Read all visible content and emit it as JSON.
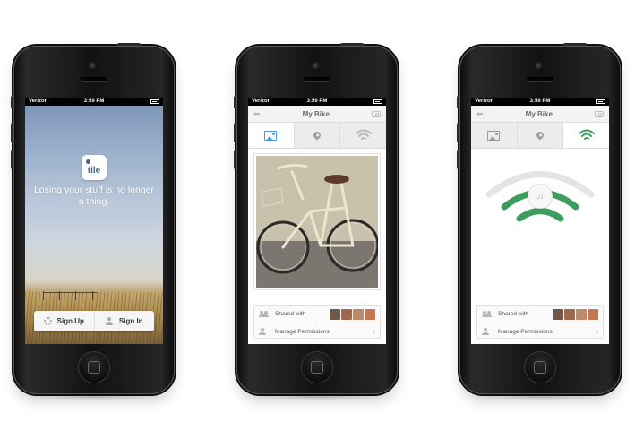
{
  "phones": [
    {
      "status": {
        "carrier": "Verizon",
        "time": "3:59 PM"
      },
      "login": {
        "logo_text": "tile",
        "tagline": "Losing your stuff is no longer a thing.",
        "signup_label": "Sign Up",
        "signin_label": "Sign In"
      }
    },
    {
      "status": {
        "carrier": "Verizon",
        "time": "3:59 PM"
      },
      "nav": {
        "title": "My Bike",
        "back_icon": "arrow-left-icon",
        "action_icon": "camera-icon"
      },
      "tabs": [
        {
          "icon": "photo-icon",
          "active": true
        },
        {
          "icon": "location-pin-icon",
          "active": false
        },
        {
          "icon": "wifi-signal-icon",
          "active": false
        }
      ],
      "share": {
        "shared_label": "Shared with",
        "manage_label": "Manage Permissions"
      }
    },
    {
      "status": {
        "carrier": "Verizon",
        "time": "3:59 PM"
      },
      "nav": {
        "title": "My Bike",
        "back_icon": "arrow-left-icon",
        "action_icon": "camera-icon"
      },
      "tabs": [
        {
          "icon": "photo-icon",
          "active": false
        },
        {
          "icon": "location-pin-icon",
          "active": false
        },
        {
          "icon": "wifi-signal-icon",
          "active": true
        }
      ],
      "share": {
        "shared_label": "Shared with",
        "manage_label": "Manage Permissions"
      },
      "signal_level": 0.66,
      "play_icon": "music-note-icon"
    }
  ],
  "colors": {
    "active_blue": "#4a9ad8",
    "signal_green": "#3e9d5e",
    "signal_inactive": "#e4e4e4"
  },
  "avatar_colors": [
    "#6b5a4a",
    "#a0684d",
    "#b98a6d",
    "#c27652"
  ]
}
